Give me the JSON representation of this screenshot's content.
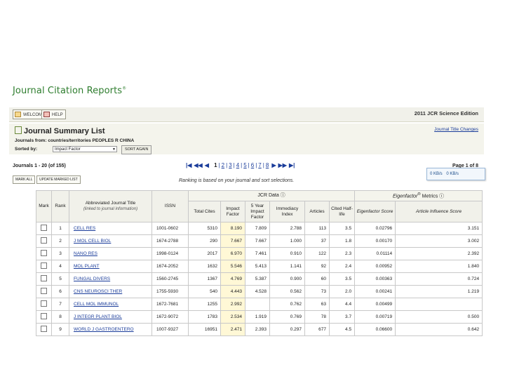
{
  "logo": {
    "text": "Journal Citation Reports",
    "reg": "®"
  },
  "toolbar": {
    "welcome_label": "WELCOME",
    "help_label": "HELP",
    "edition": "2011 JCR Science Edition"
  },
  "summary": {
    "title": "Journal Summary List",
    "title_changes_link": "Journal Title Changes",
    "journals_from_label": "Journals from:",
    "journals_from_value": "countries/territories PEOPLES R CHINA",
    "sorted_by_label": "Sorted by:",
    "sort_value": "Impact Factor",
    "sort_button": "SORT AGAIN"
  },
  "pagination": {
    "count": "Journals 1 - 20 (of 155)",
    "pages": [
      "1",
      "2",
      "3",
      "4",
      "5",
      "6",
      "7",
      "8"
    ],
    "page_of": "Page 1 of 8",
    "ranking_note": "Ranking is based on your journal and sort selections."
  },
  "actions": {
    "mark_all": "MARK ALL",
    "update_marked": "UPDATE MARKED LIST"
  },
  "table": {
    "group_jcr": "JCR Data",
    "group_eigen": "Eigenfactor",
    "group_eigen_suffix": "Metrics",
    "headers": {
      "mark": "Mark",
      "rank": "Rank",
      "title": "Abbreviated Journal Title",
      "title_sub": "(linked to journal information)",
      "issn": "ISSN",
      "total_cites": "Total Cites",
      "impact_factor": "Impact Factor",
      "five_year": "5 Year Impact Factor",
      "immediacy": "Immediacy Index",
      "articles": "Articles",
      "half_life": "Cited Half-life",
      "eigen_score": "Eigenfactor Score",
      "ai_score": "Article Influence Score"
    },
    "rows": [
      {
        "rank": "1",
        "title": "CELL RES",
        "issn": "1001-0602",
        "cites": "5310",
        "if": "8.190",
        "fy": "7.809",
        "imm": "2.788",
        "art": "113",
        "hl": "3.5",
        "eig": "0.02796",
        "ai": "3.151"
      },
      {
        "rank": "2",
        "title": "J MOL CELL BIOL",
        "issn": "1674-2788",
        "cites": "290",
        "if": "7.667",
        "fy": "7.667",
        "imm": "1.000",
        "art": "37",
        "hl": "1.8",
        "eig": "0.00170",
        "ai": "3.002"
      },
      {
        "rank": "3",
        "title": "NANO RES",
        "issn": "1998-0124",
        "cites": "2017",
        "if": "6.970",
        "fy": "7.461",
        "imm": "0.910",
        "art": "122",
        "hl": "2.3",
        "eig": "0.01114",
        "ai": "2.392"
      },
      {
        "rank": "4",
        "title": "MOL PLANT",
        "issn": "1674-2052",
        "cites": "1632",
        "if": "5.546",
        "fy": "5.413",
        "imm": "1.141",
        "art": "92",
        "hl": "2.4",
        "eig": "0.00952",
        "ai": "1.840"
      },
      {
        "rank": "5",
        "title": "FUNGAL DIVERS",
        "issn": "1560-2745",
        "cites": "1367",
        "if": "4.769",
        "fy": "5.387",
        "imm": "0.900",
        "art": "60",
        "hl": "3.5",
        "eig": "0.00363",
        "ai": "0.724"
      },
      {
        "rank": "6",
        "title": "CNS NEUROSCI THER",
        "issn": "1755-5930",
        "cites": "540",
        "if": "4.443",
        "fy": "4.528",
        "imm": "0.562",
        "art": "73",
        "hl": "2.0",
        "eig": "0.00241",
        "ai": "1.219"
      },
      {
        "rank": "7",
        "title": "CELL MOL IMMUNOL",
        "issn": "1672-7681",
        "cites": "1255",
        "if": "2.992",
        "fy": "",
        "imm": "0.762",
        "art": "63",
        "hl": "4.4",
        "eig": "0.00499",
        "ai": ""
      },
      {
        "rank": "8",
        "title": "J INTEGR PLANT BIOL",
        "issn": "1672-9072",
        "cites": "1783",
        "if": "2.534",
        "fy": "1.919",
        "imm": "0.769",
        "art": "78",
        "hl": "3.7",
        "eig": "0.00719",
        "ai": "0.500"
      },
      {
        "rank": "9",
        "title": "WORLD J GASTROENTERO",
        "issn": "1007-9327",
        "cites": "16951",
        "if": "2.471",
        "fy": "2.393",
        "imm": "0.297",
        "art": "677",
        "hl": "4.5",
        "eig": "0.06600",
        "ai": "0.642"
      }
    ]
  },
  "float_toolbar": {
    "a": "0 KB/s",
    "b": "0 KB/s"
  }
}
